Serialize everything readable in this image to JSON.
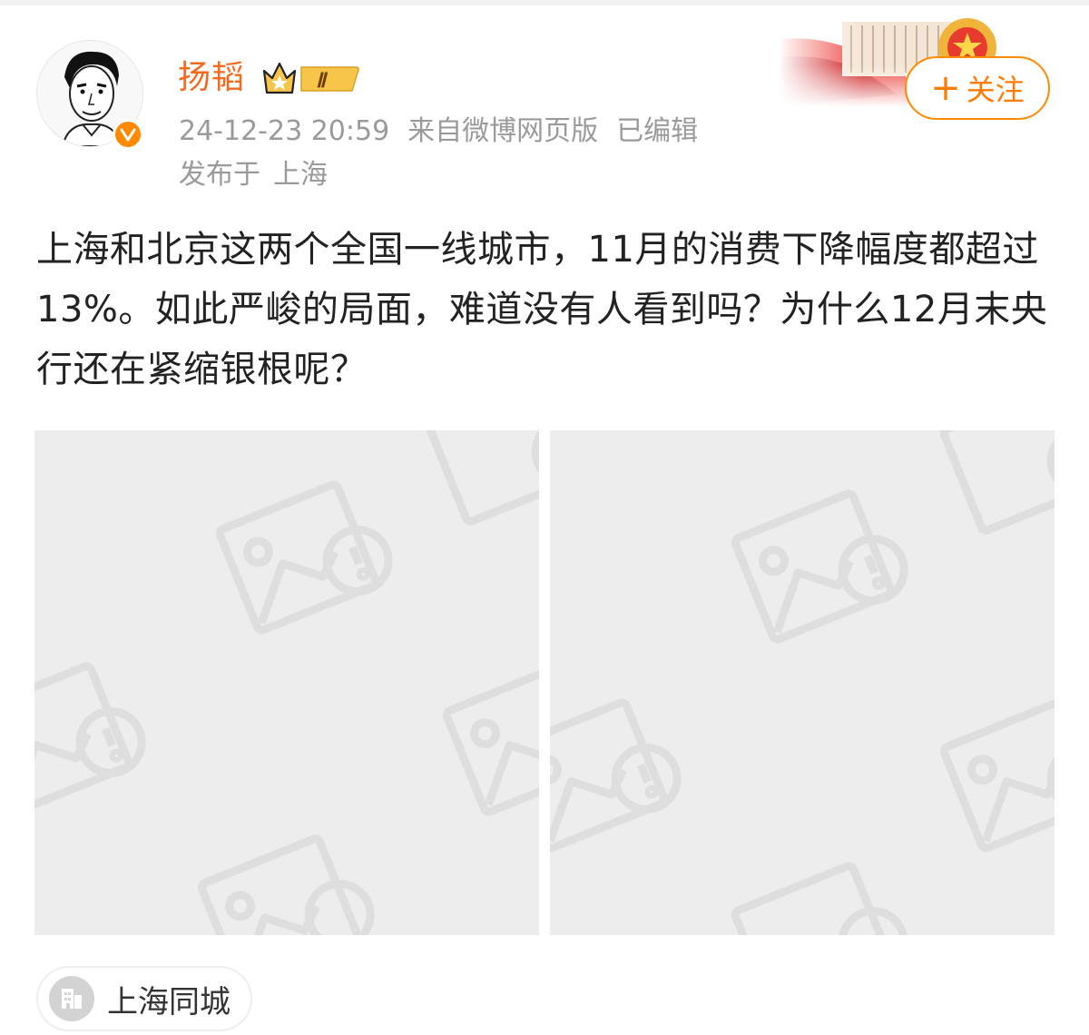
{
  "user": {
    "name": "扬韬",
    "vip_level": "Ⅱ",
    "verified_mark": "v",
    "avatar_icon": "portrait-sketch",
    "verified_icon": "verified-badge-icon"
  },
  "meta": {
    "timestamp": "24-12-23 20:59",
    "source": "来自微博网页版",
    "edited": "已编辑"
  },
  "location": {
    "prefix": "发布于",
    "city": "上海"
  },
  "follow_button": {
    "plus": "+",
    "label": "关注"
  },
  "post": {
    "text": "上海和北京这两个全国一线城市，11月的消费下降幅度都超过13%。如此严峻的局面，难道没有人看到吗？为什么12月末央行还在紧缩银根呢？"
  },
  "images": [
    {
      "state": "broken-image-placeholder",
      "icon": "image-error-icon"
    },
    {
      "state": "broken-image-placeholder",
      "icon": "image-error-icon"
    }
  ],
  "location_tag": {
    "label": "上海同城",
    "icon": "building-icon"
  },
  "colors": {
    "username": "#f26a1b",
    "accent": "#ff8a00",
    "meta_text": "#9a9a9a",
    "body_text": "#222222",
    "placeholder_bg": "#ededed"
  }
}
